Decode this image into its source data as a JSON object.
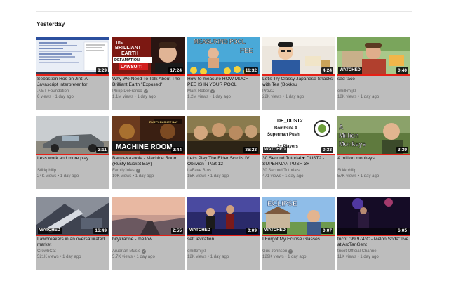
{
  "section": {
    "title": "Yesterday"
  },
  "colors": {
    "progress": "#e62117",
    "card_bg": "#bdbdbd"
  },
  "videos": [
    {
      "title": "Sebastien Ros on Jint: A Javascript Interpreter for",
      "channel": ".NET Foundation",
      "verified": false,
      "views": "6 views",
      "age": "1 day ago",
      "duration": "8:29",
      "watched": false,
      "progress": 1.0
    },
    {
      "title": "Why We Need To Talk About The Brilliant Earth \"Exposed\"",
      "channel": "Philip DeFranco",
      "verified": true,
      "views": "1.1M views",
      "age": "1 day ago",
      "duration": "17:24",
      "watched": false,
      "progress": 1.0,
      "thumb_text": [
        "THE",
        "BRILLIANT",
        "EARTH",
        "DEFAMATION",
        "LAWSUIT!"
      ]
    },
    {
      "title": "How to measure HOW MUCH PEE IS IN YOUR POOL",
      "channel": "Mark Rober",
      "verified": true,
      "views": "1.2M views",
      "age": "1 day ago",
      "duration": "11:32",
      "watched": false,
      "progress": 1.0,
      "thumb_text": [
        "MEASURING POOL",
        "PEE"
      ]
    },
    {
      "title": "Let's Try Classy Japanese Snacks with Tea (Bokksu",
      "channel": "ProZD",
      "verified": false,
      "views": "22K views",
      "age": "1 day ago",
      "duration": "4:24",
      "watched": false,
      "progress": 1.0
    },
    {
      "title": "sad face",
      "channel": "emilkmijkl",
      "verified": false,
      "views": "18K views",
      "age": "1 day ago",
      "duration": "0:40",
      "watched": true,
      "progress": 1.0
    },
    {
      "title": "Less work and more play",
      "channel": "Stikkphilip",
      "verified": false,
      "views": "24K views",
      "age": "1 day ago",
      "duration": "3:11",
      "watched": false,
      "progress": 1.0
    },
    {
      "title": "Banjo-Kazooie - Machine Room (Rusty Bucket Bay)",
      "channel": "FamilyJules",
      "verified": true,
      "views": "10K views",
      "age": "1 day ago",
      "duration": "2:44",
      "watched": false,
      "progress": 1.0,
      "thumb_text": [
        "RUSTY BUCKET BAY",
        "MACHINE ROOM"
      ]
    },
    {
      "title": "Let's Play The Elder Scrolls IV: Oblivion - Part 12",
      "channel": "LaFave Bros",
      "verified": false,
      "views": "15K views",
      "age": "1 day ago",
      "duration": "36:23",
      "watched": false,
      "progress": 1.0
    },
    {
      "title": "30 Second Tutorial ♥ DUST2 - SUPERMAN PUSH 3+",
      "channel": "30 Second Tutorials",
      "verified": false,
      "views": "471 views",
      "age": "1 day ago",
      "duration": "0:33",
      "watched": true,
      "progress": 1.0,
      "thumb_text": [
        "DE_DUST2",
        "Bombsite A",
        "Superman Push",
        "3+ Players"
      ]
    },
    {
      "title": "A million monkeys",
      "channel": "Stikkphilip",
      "verified": false,
      "views": "57K views",
      "age": "1 day ago",
      "duration": "3:39",
      "watched": false,
      "progress": 1.0,
      "thumb_text": [
        "A",
        "Million",
        "Monkeys"
      ]
    },
    {
      "title": "Lawbreakers in an oversaturated market",
      "channel": "CrowbCat",
      "verified": false,
      "views": "521K views",
      "age": "1 day ago",
      "duration": "16:49",
      "watched": true,
      "progress": 1.0
    },
    {
      "title": "bitykradne - mellow",
      "channel": "Aruarian Music",
      "verified": true,
      "views": "5.7K views",
      "age": "1 day ago",
      "duration": "2:55",
      "watched": false,
      "progress": 1.0
    },
    {
      "title": "self levitation",
      "channel": "emilkmijkl",
      "verified": false,
      "views": "12K views",
      "age": "1 day ago",
      "duration": "0:09",
      "watched": true,
      "progress": 1.0
    },
    {
      "title": "I Forgot My Eclipse Glasses",
      "channel": "Gus Johnson",
      "verified": true,
      "views": "129K views",
      "age": "1 day ago",
      "duration": "0:07",
      "watched": true,
      "progress": 1.0,
      "thumb_text": [
        "ECLIPSE"
      ]
    },
    {
      "title": "tricot \"99.974°C - Melon Soda\" live at ArcTanGent",
      "channel": "tricot Official Channel",
      "verified": false,
      "views": "11K views",
      "age": "1 day ago",
      "duration": "6:05",
      "watched": false,
      "progress": 1.0
    }
  ]
}
